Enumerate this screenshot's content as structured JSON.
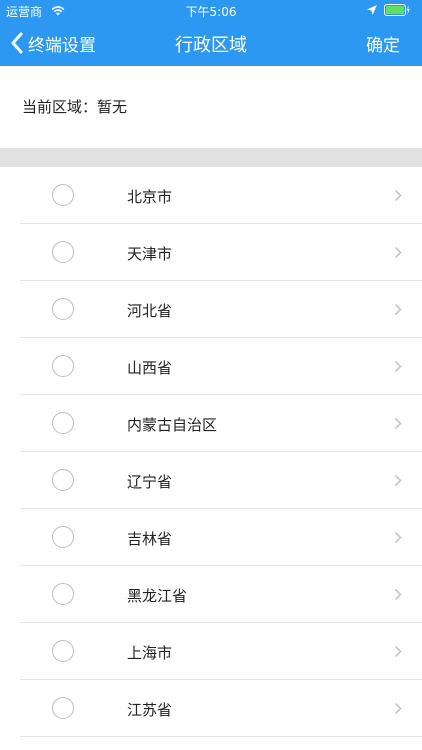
{
  "status_bar": {
    "carrier": "运营商",
    "time": "下午5:06",
    "icons": [
      "wifi-icon",
      "location-arrow-icon",
      "battery-icon"
    ]
  },
  "nav": {
    "back_label": "终端设置",
    "title": "行政区域",
    "confirm_label": "确定"
  },
  "current_region": {
    "text": "当前区域：暂无"
  },
  "regions": [
    {
      "label": "北京市"
    },
    {
      "label": "天津市"
    },
    {
      "label": "河北省"
    },
    {
      "label": "山西省"
    },
    {
      "label": "内蒙古自治区"
    },
    {
      "label": "辽宁省"
    },
    {
      "label": "吉林省"
    },
    {
      "label": "黑龙江省"
    },
    {
      "label": "上海市"
    },
    {
      "label": "江苏省"
    }
  ],
  "colors": {
    "header_blue": "#2d98f2",
    "separator": "#e6e6e6",
    "band_gray": "#e1e1e1"
  }
}
